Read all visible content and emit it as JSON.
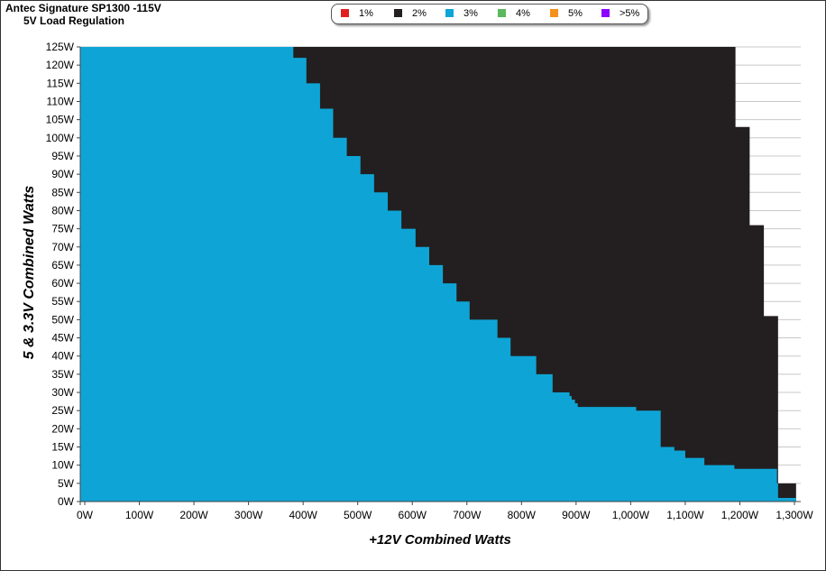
{
  "header": {
    "title": "Antec Signature  SP1300 -115V",
    "subtitle": "5V Load Regulation"
  },
  "legend": [
    {
      "label": "1%",
      "color": "#e02020"
    },
    {
      "label": "2%",
      "color": "#231f20"
    },
    {
      "label": "3%",
      "color": "#0ea5d6"
    },
    {
      "label": "4%",
      "color": "#5cb85c"
    },
    {
      "label": "5%",
      "color": "#f5901e"
    },
    {
      "label": ">5%",
      "color": "#8b00ff"
    }
  ],
  "chart_data": {
    "type": "heatmap",
    "title": "Antec Signature  SP1300 -115V",
    "subtitle": "5V Load Regulation",
    "xlabel": "+12V Combined Watts",
    "ylabel": "5 & 3.3V Combined Watts",
    "xlim": [
      0,
      1300
    ],
    "ylim": [
      0,
      125
    ],
    "x_ticks": [
      "0W",
      "100W",
      "200W",
      "300W",
      "400W",
      "500W",
      "600W",
      "700W",
      "800W",
      "900W",
      "1,000W",
      "1,100W",
      "1,200W",
      "1,300W"
    ],
    "y_ticks": [
      "0W",
      "5W",
      "10W",
      "15W",
      "20W",
      "25W",
      "30W",
      "35W",
      "40W",
      "45W",
      "50W",
      "55W",
      "60W",
      "65W",
      "70W",
      "75W",
      "80W",
      "85W",
      "90W",
      "95W",
      "100W",
      "105W",
      "110W",
      "115W",
      "120W",
      "125W"
    ],
    "grid": true,
    "legend_position": "top",
    "colors": {
      "2%": "#231f20",
      "3%": "#0ea5d6"
    },
    "region_2pct_max_x": [
      [
        0,
        1303
      ],
      [
        1,
        1303
      ],
      [
        5,
        1270
      ],
      [
        7,
        1270
      ],
      [
        9,
        1270
      ],
      [
        10,
        1270
      ],
      [
        15,
        1270
      ],
      [
        25,
        1270
      ],
      [
        26,
        1270
      ],
      [
        51,
        1244
      ],
      [
        76,
        1218
      ],
      [
        103,
        1192
      ],
      [
        125,
        1166
      ]
    ],
    "region_3pct_max_x": [
      [
        0,
        1303
      ],
      [
        1,
        1270
      ],
      [
        5,
        1268
      ],
      [
        7,
        1268
      ],
      [
        8,
        1268
      ],
      [
        9,
        1190
      ],
      [
        10,
        1135
      ],
      [
        12,
        1100
      ],
      [
        14,
        1080
      ],
      [
        15,
        1055
      ],
      [
        25,
        1010
      ],
      [
        26,
        903
      ],
      [
        27,
        898
      ],
      [
        28,
        892
      ],
      [
        29,
        888
      ],
      [
        30,
        857
      ],
      [
        35,
        827
      ],
      [
        40,
        780
      ],
      [
        45,
        756
      ],
      [
        50,
        705
      ],
      [
        55,
        681
      ],
      [
        60,
        656
      ],
      [
        65,
        631
      ],
      [
        70,
        606
      ],
      [
        75,
        580
      ],
      [
        80,
        555
      ],
      [
        85,
        530
      ],
      [
        90,
        505
      ],
      [
        95,
        480
      ],
      [
        100,
        455
      ],
      [
        108,
        431
      ],
      [
        115,
        406
      ],
      [
        122,
        382
      ],
      [
        125,
        388
      ]
    ]
  }
}
